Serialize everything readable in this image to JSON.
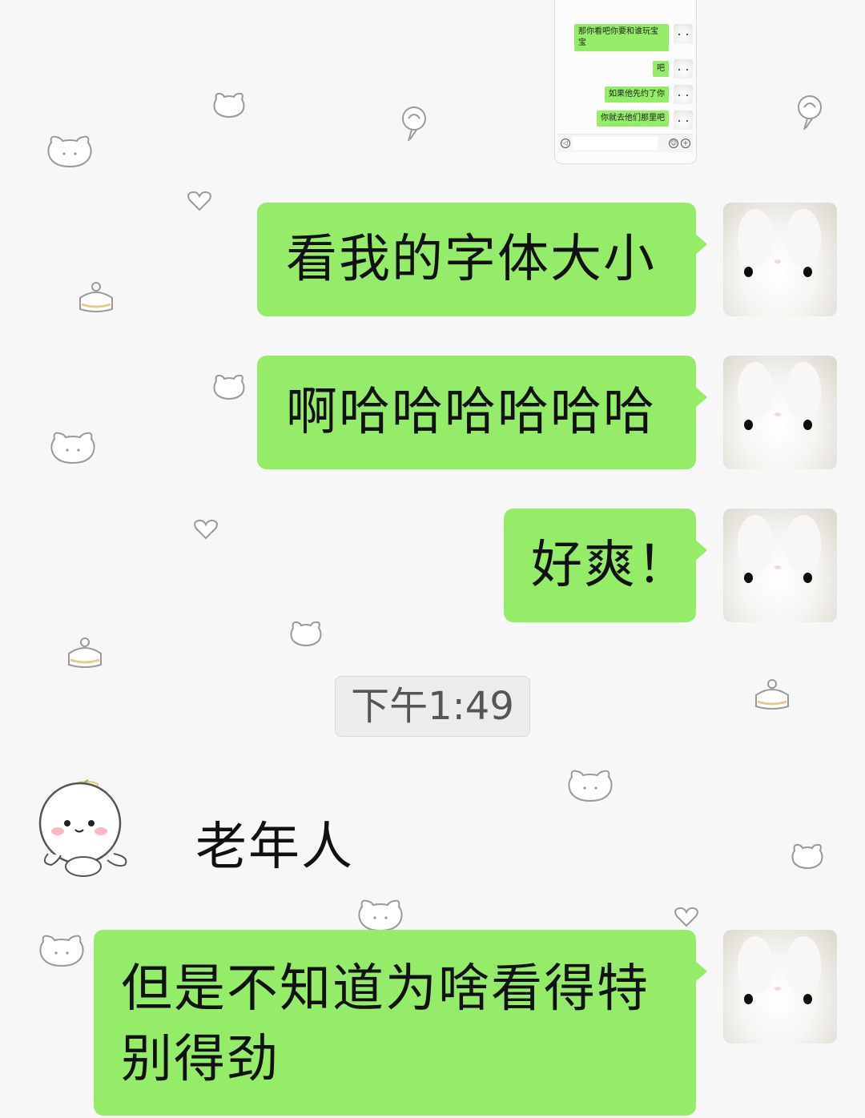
{
  "preview": {
    "messages": [
      {
        "text": "那你看吧你要和谁玩宝宝"
      },
      {
        "text": "吧"
      },
      {
        "text": "如果他先约了你"
      },
      {
        "text": "你就去他们那里吧"
      }
    ]
  },
  "messages": [
    {
      "text": "看我的字体大小"
    },
    {
      "text": "啊哈哈哈哈哈哈"
    },
    {
      "text": "好爽！"
    }
  ],
  "timestamp": "下午1:49",
  "incoming": {
    "text": "老年人"
  },
  "last_message": {
    "line1": "但是不知道为啥看得特",
    "line2": "别得劲"
  },
  "colors": {
    "bubble": "#95ec69",
    "background": "#f7f7f7"
  }
}
